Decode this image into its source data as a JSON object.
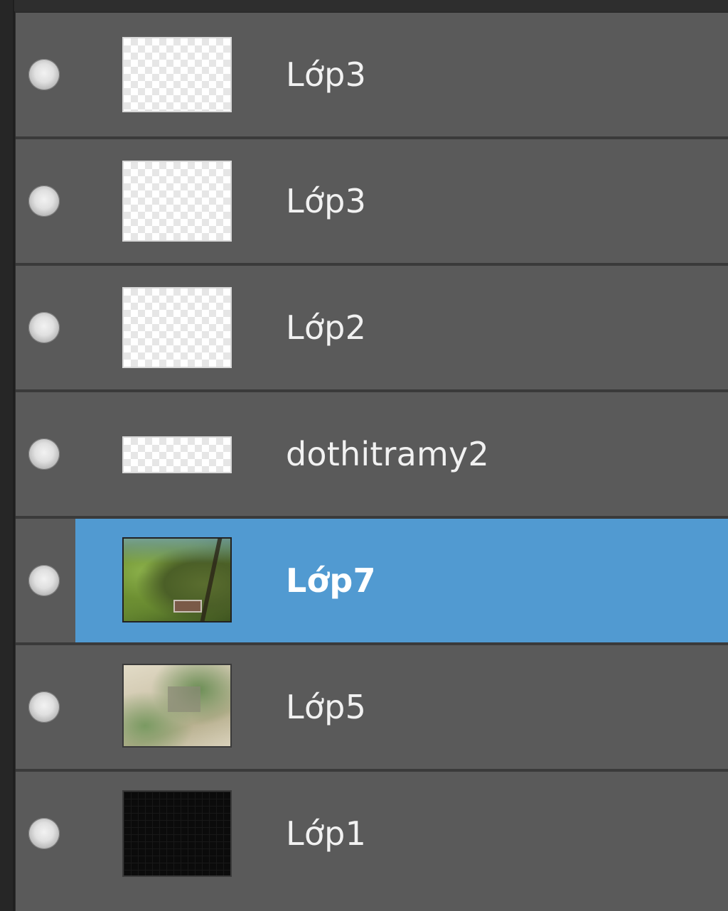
{
  "layers_panel": {
    "layers": [
      {
        "name": "Lớp3",
        "thumbnail": "transparent",
        "selected": false,
        "visible": true
      },
      {
        "name": "Lớp3",
        "thumbnail": "transparent",
        "selected": false,
        "visible": true
      },
      {
        "name": "Lớp2",
        "thumbnail": "transparent",
        "selected": false,
        "visible": true
      },
      {
        "name": "dothitramy2",
        "thumbnail": "transparent-wide",
        "selected": false,
        "visible": true
      },
      {
        "name": "Lớp7",
        "thumbnail": "photo-green-house",
        "selected": true,
        "visible": true
      },
      {
        "name": "Lớp5",
        "thumbnail": "photo-beige-garden",
        "selected": false,
        "visible": true
      },
      {
        "name": "Lớp1",
        "thumbnail": "black-fill",
        "selected": false,
        "visible": true
      }
    ],
    "icons": {
      "visibility": "eye-toggle-icon"
    },
    "colors": {
      "row_background": "#5a5a5a",
      "selected_background": "#519ad1",
      "separator": "#3a3a3a",
      "text": "#f1f1f1"
    }
  }
}
